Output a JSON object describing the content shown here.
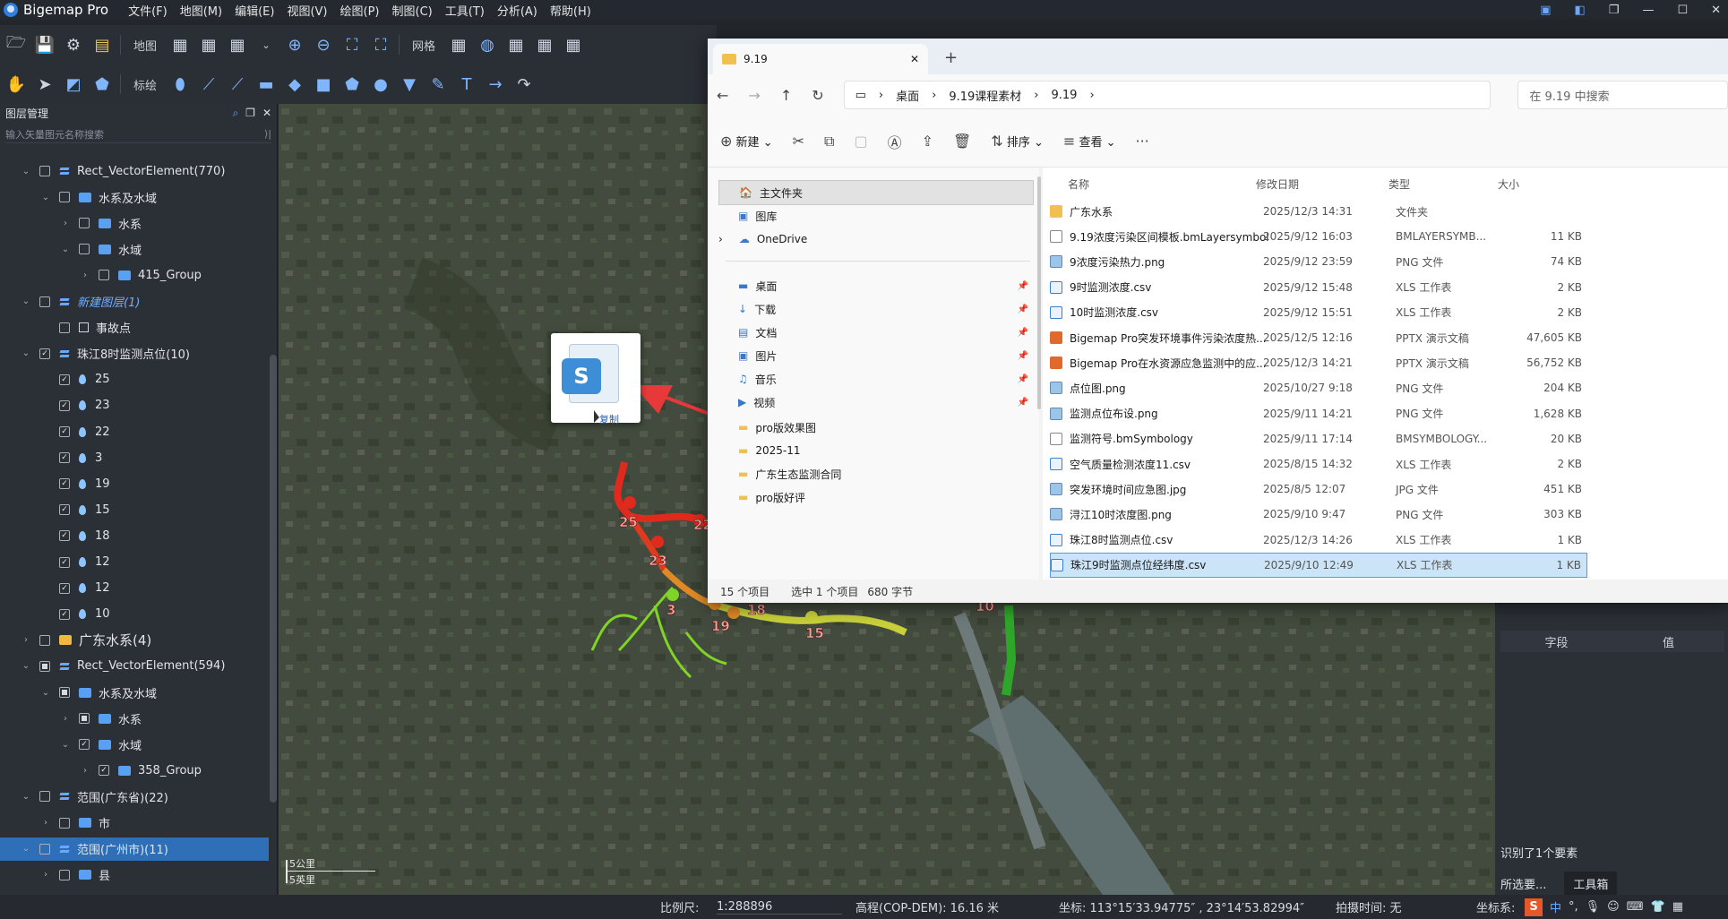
{
  "app": {
    "name": "Bigemap Pro",
    "menus": [
      "文件(F)",
      "地图(M)",
      "编辑(E)",
      "视图(V)",
      "绘图(P)",
      "制图(C)",
      "工具(T)",
      "分析(A)",
      "帮助(H)"
    ]
  },
  "toolbar1": {
    "map_label": "地图",
    "grid_label": "网格"
  },
  "toolbar2": {
    "annotate_label": "标绘"
  },
  "layer_panel": {
    "title": "图层管理",
    "search_placeholder": "输入矢量图元名称搜索",
    "rows": [
      {
        "label": "Rect_VectorElement(770)"
      },
      {
        "label": "水系及水域"
      },
      {
        "label": "水系"
      },
      {
        "label": "水域"
      },
      {
        "label": "415_Group"
      },
      {
        "label": "新建图层(1)"
      },
      {
        "label": "事故点"
      },
      {
        "label": "珠江8时监测点位(10)"
      },
      {
        "label": "25"
      },
      {
        "label": "23"
      },
      {
        "label": "22"
      },
      {
        "label": "3"
      },
      {
        "label": "19"
      },
      {
        "label": "15"
      },
      {
        "label": "18"
      },
      {
        "label": "12"
      },
      {
        "label": "12"
      },
      {
        "label": "10"
      },
      {
        "label": "广东水系(4)"
      },
      {
        "label": "Rect_VectorElement(594)"
      },
      {
        "label": "水系及水域"
      },
      {
        "label": "水系"
      },
      {
        "label": "水域"
      },
      {
        "label": "358_Group"
      },
      {
        "label": "范围(广东省)(22)"
      },
      {
        "label": "市"
      },
      {
        "label": "范围(广州市)(11)"
      },
      {
        "label": "县"
      }
    ]
  },
  "map": {
    "scale_km": "5公里",
    "scale_mi": "5英里",
    "point_labels": [
      "25",
      "22",
      "23",
      "3",
      "18",
      "19",
      "15",
      "10"
    ],
    "colors": {
      "high": "#e02a1e",
      "mid": "#e08a26",
      "low": "#7fd426",
      "river": "#c8d03a"
    }
  },
  "drag": {
    "copy_label": "复制",
    "icon_letter": "S"
  },
  "explorer": {
    "tab_title": "9.19",
    "breadcrumb": [
      "桌面",
      "9.19课程素材",
      "9.19"
    ],
    "search_placeholder": "在 9.19 中搜索",
    "cmd": {
      "new": "新建",
      "sort": "排序",
      "view": "查看"
    },
    "nav": [
      {
        "label": "主文件夹"
      },
      {
        "label": "图库"
      },
      {
        "label": "OneDrive"
      },
      {
        "label": "桌面"
      },
      {
        "label": "下载"
      },
      {
        "label": "文档"
      },
      {
        "label": "图片"
      },
      {
        "label": "音乐"
      },
      {
        "label": "视频"
      },
      {
        "label": "pro版效果图"
      },
      {
        "label": "2025-11"
      },
      {
        "label": "广东生态监测合同"
      },
      {
        "label": "pro版好评"
      }
    ],
    "columns": {
      "name": "名称",
      "date": "修改日期",
      "type": "类型",
      "size": "大小"
    },
    "files": [
      {
        "name": "广东水系",
        "date": "2025/12/3 14:31",
        "type": "文件夹",
        "size": "",
        "kind": "folder"
      },
      {
        "name": "9.19浓度污染区间模板.bmLayersymbol",
        "date": "2025/9/12 16:03",
        "type": "BMLAYERSYMB...",
        "size": "11 KB",
        "kind": "doc"
      },
      {
        "name": "9浓度污染热力.png",
        "date": "2025/9/12 23:59",
        "type": "PNG 文件",
        "size": "74 KB",
        "kind": "png"
      },
      {
        "name": "9时监测浓度.csv",
        "date": "2025/9/12 15:48",
        "type": "XLS 工作表",
        "size": "2 KB",
        "kind": "xls"
      },
      {
        "name": "10时监测浓度.csv",
        "date": "2025/9/12 15:51",
        "type": "XLS 工作表",
        "size": "2 KB",
        "kind": "xls"
      },
      {
        "name": "Bigemap Pro突发环境事件污染浓度热...",
        "date": "2025/12/5 12:16",
        "type": "PPTX 演示文稿",
        "size": "47,605 KB",
        "kind": "ppt"
      },
      {
        "name": "Bigemap Pro在水资源应急监测中的应...",
        "date": "2025/12/3 14:21",
        "type": "PPTX 演示文稿",
        "size": "56,752 KB",
        "kind": "ppt"
      },
      {
        "name": "点位图.png",
        "date": "2025/10/27 9:18",
        "type": "PNG 文件",
        "size": "204 KB",
        "kind": "png"
      },
      {
        "name": "监测点位布设.png",
        "date": "2025/9/11 14:21",
        "type": "PNG 文件",
        "size": "1,628 KB",
        "kind": "png"
      },
      {
        "name": "监测符号.bmSymbology",
        "date": "2025/9/11 17:14",
        "type": "BMSYMBOLOGY...",
        "size": "20 KB",
        "kind": "doc"
      },
      {
        "name": "空气质量检测浓度11.csv",
        "date": "2025/8/15 14:32",
        "type": "XLS 工作表",
        "size": "2 KB",
        "kind": "xls"
      },
      {
        "name": "突发环境时间应急图.jpg",
        "date": "2025/8/5 12:07",
        "type": "JPG 文件",
        "size": "451 KB",
        "kind": "png"
      },
      {
        "name": "浔江10时浓度图.png",
        "date": "2025/9/10 9:47",
        "type": "PNG 文件",
        "size": "303 KB",
        "kind": "png"
      },
      {
        "name": "珠江8时监测点位.csv",
        "date": "2025/12/3 14:26",
        "type": "XLS 工作表",
        "size": "1 KB",
        "kind": "xls"
      },
      {
        "name": "珠江9时监测点位经纬度.csv",
        "date": "2025/9/10 12:49",
        "type": "XLS 工作表",
        "size": "1 KB",
        "kind": "xls"
      }
    ],
    "status": {
      "count": "15 个项目",
      "selected": "选中 1 个项目",
      "bytes": "680 字节"
    }
  },
  "right_panel": {
    "field_col": "字段",
    "value_col": "值",
    "info": "识别了1个要素",
    "select_label": "所选要...",
    "toolbox_label": "工具箱"
  },
  "statusbar": {
    "scale_label": "比例尺:",
    "scale_value": "1:288896",
    "elev": "高程(COP-DEM): 16.16 米",
    "coords": "坐标: 113°15′33.94775″ , 23°14′53.82994″",
    "shot": "拍摄时间: 无",
    "crs": "坐标系:",
    "ime": "中"
  }
}
